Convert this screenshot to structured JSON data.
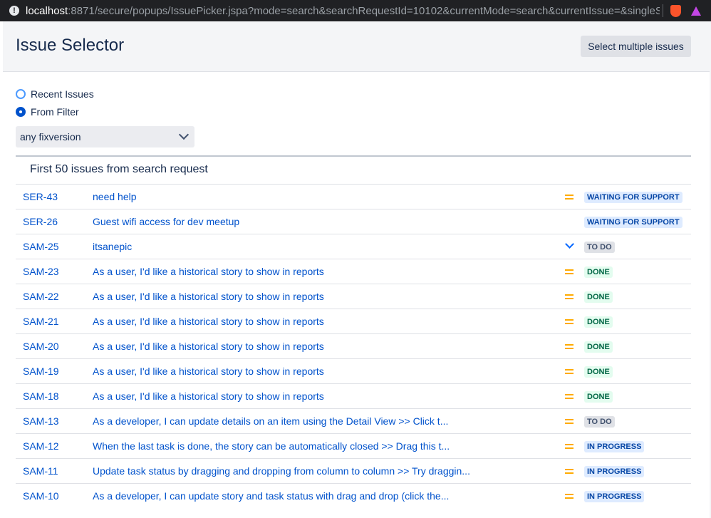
{
  "browser": {
    "url_host": "localhost",
    "url_rest": ":8871/secure/popups/IssuePicker.jspa?mode=search&searchRequestId=10102&currentMode=search&currentIssue=&singleSelect..."
  },
  "header": {
    "title": "Issue Selector",
    "multi_button": "Select multiple issues"
  },
  "mode": {
    "recent_label": "Recent Issues",
    "filter_label": "From Filter",
    "selected": "From Filter",
    "filter_value": "any fixversion"
  },
  "results": {
    "title": "First 50 issues from search request",
    "issues": [
      {
        "key": "SER-43",
        "summary": "need help",
        "priority": "medium-icon",
        "status": "WAITING FOR SUPPORT",
        "status_color": "blue"
      },
      {
        "key": "SER-26",
        "summary": "Guest wifi access for dev meetup",
        "priority": "none",
        "status": "WAITING FOR SUPPORT",
        "status_color": "blue"
      },
      {
        "key": "SAM-25",
        "summary": "itsanepic",
        "priority": "low-icon",
        "status": "TO DO",
        "status_color": "gray"
      },
      {
        "key": "SAM-23",
        "summary": "As a user, I'd like a historical story to show in reports",
        "priority": "medium-icon",
        "status": "DONE",
        "status_color": "green"
      },
      {
        "key": "SAM-22",
        "summary": "As a user, I'd like a historical story to show in reports",
        "priority": "medium-icon",
        "status": "DONE",
        "status_color": "green"
      },
      {
        "key": "SAM-21",
        "summary": "As a user, I'd like a historical story to show in reports",
        "priority": "medium-icon",
        "status": "DONE",
        "status_color": "green"
      },
      {
        "key": "SAM-20",
        "summary": "As a user, I'd like a historical story to show in reports",
        "priority": "medium-icon",
        "status": "DONE",
        "status_color": "green"
      },
      {
        "key": "SAM-19",
        "summary": "As a user, I'd like a historical story to show in reports",
        "priority": "medium-icon",
        "status": "DONE",
        "status_color": "green"
      },
      {
        "key": "SAM-18",
        "summary": "As a user, I'd like a historical story to show in reports",
        "priority": "medium-icon",
        "status": "DONE",
        "status_color": "green"
      },
      {
        "key": "SAM-13",
        "summary": "As a developer, I can update details on an item using the Detail View >> Click t...",
        "priority": "medium-icon",
        "status": "TO DO",
        "status_color": "gray"
      },
      {
        "key": "SAM-12",
        "summary": "When the last task is done, the story can be automatically closed >> Drag this t...",
        "priority": "medium-icon",
        "status": "IN PROGRESS",
        "status_color": "blue"
      },
      {
        "key": "SAM-11",
        "summary": "Update task status by dragging and dropping from column to column >> Try draggin...",
        "priority": "medium-icon",
        "status": "IN PROGRESS",
        "status_color": "blue"
      },
      {
        "key": "SAM-10",
        "summary": "As a developer, I can update story and task status with drag and drop (click the...",
        "priority": "medium-icon",
        "status": "IN PROGRESS",
        "status_color": "blue"
      }
    ]
  }
}
